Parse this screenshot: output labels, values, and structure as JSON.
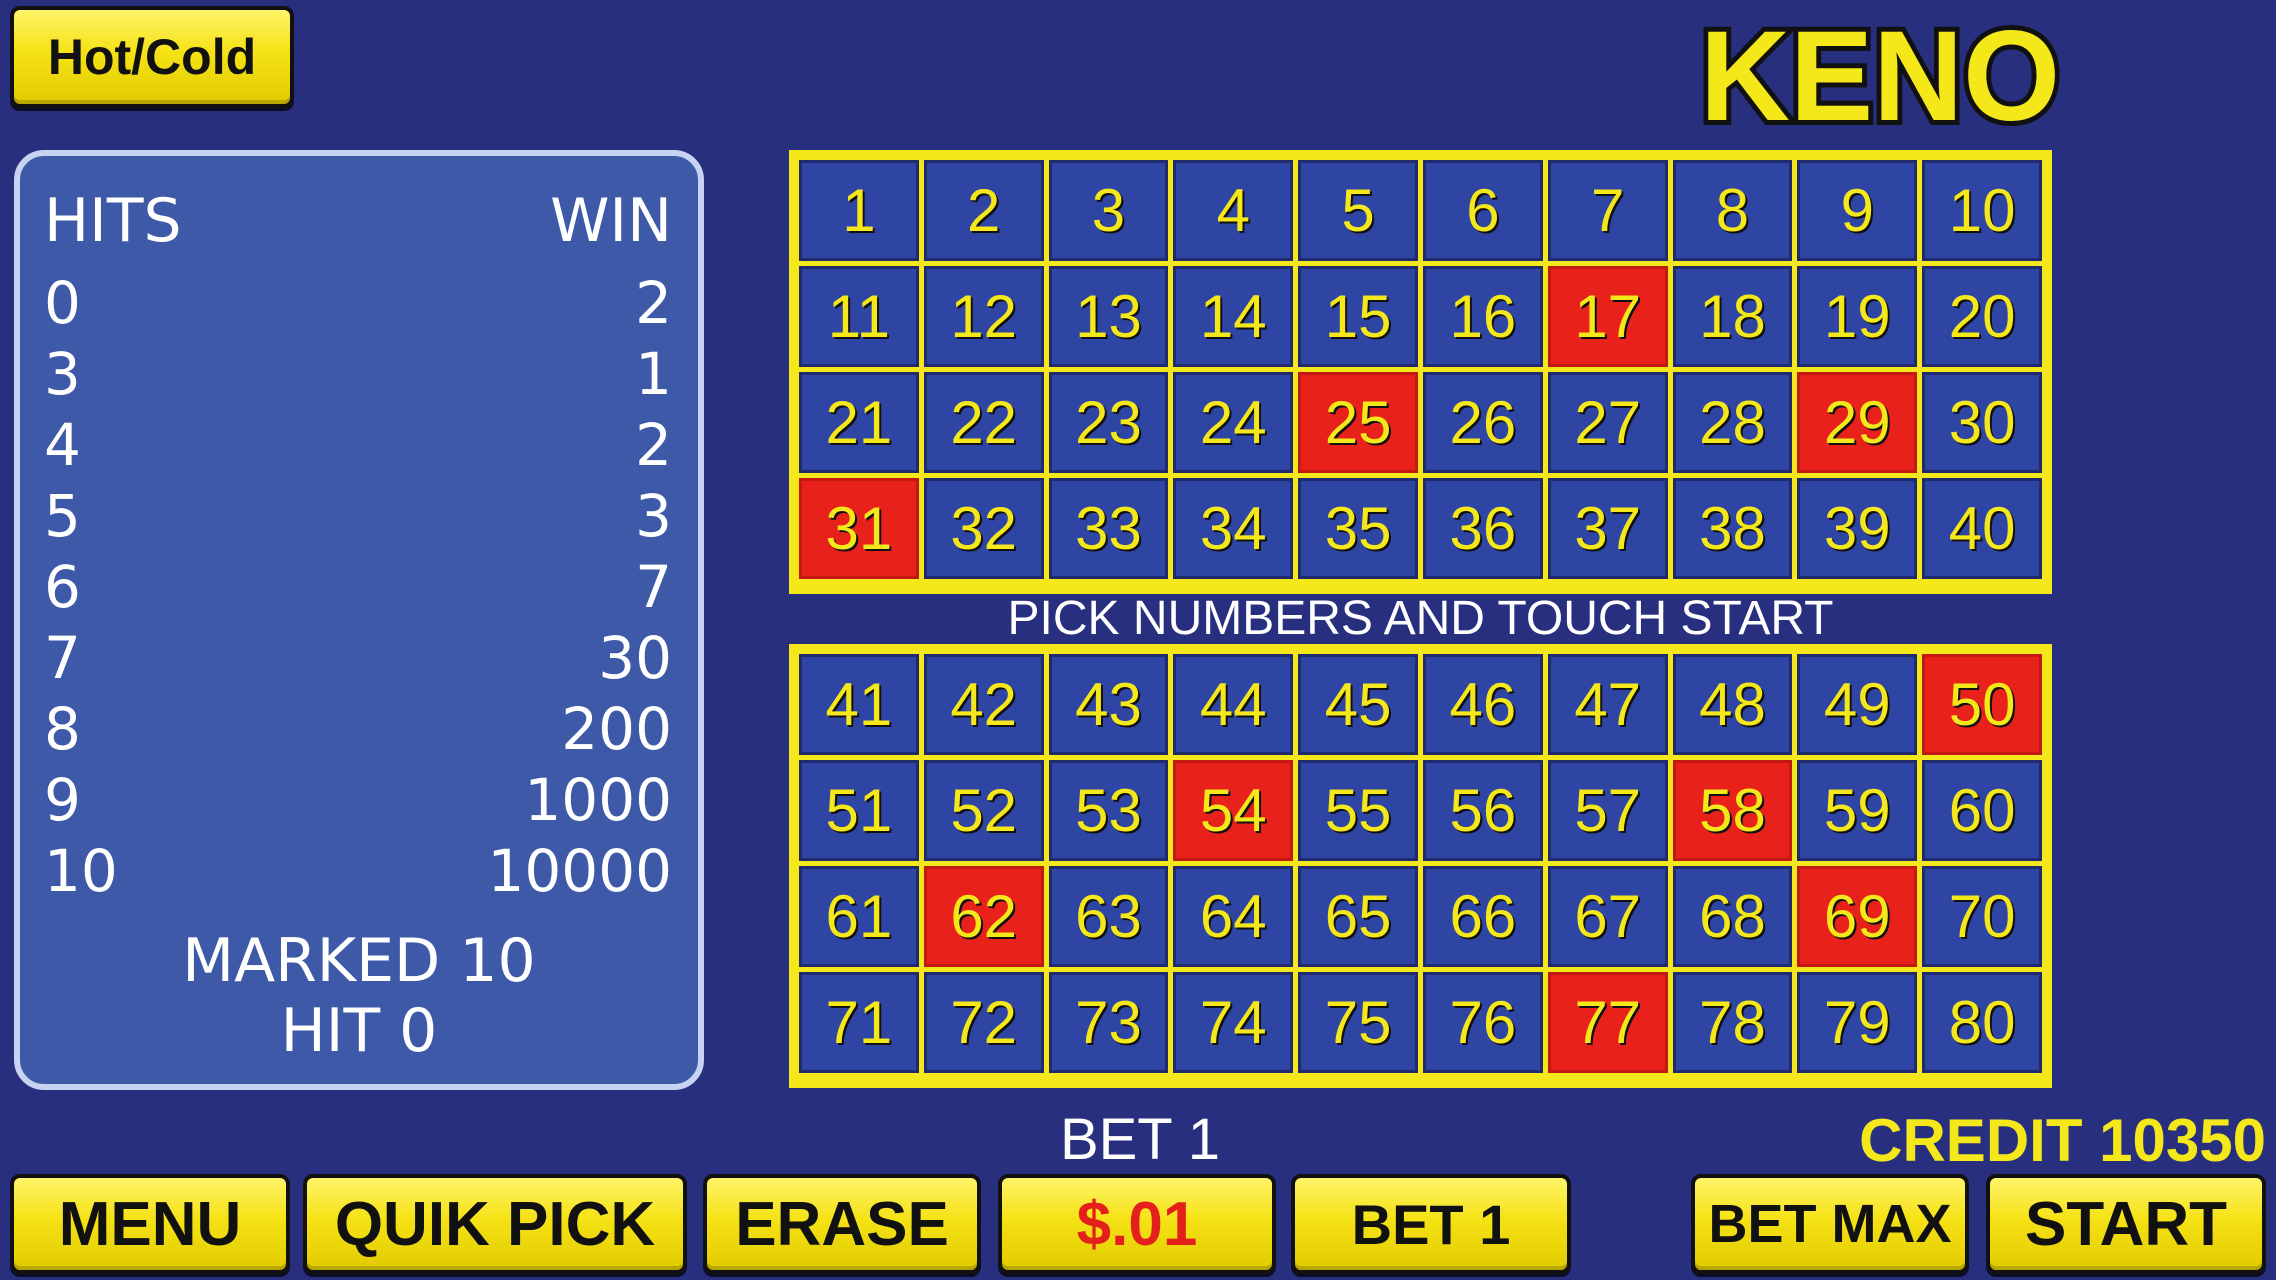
{
  "header": {
    "hotcold_label": "Hot/Cold",
    "logo_text": "KENO"
  },
  "paytable": {
    "hits_header": "HITS",
    "win_header": "WIN",
    "rows": [
      {
        "hits": "0",
        "win": "2"
      },
      {
        "hits": "3",
        "win": "1"
      },
      {
        "hits": "4",
        "win": "2"
      },
      {
        "hits": "5",
        "win": "3"
      },
      {
        "hits": "6",
        "win": "7"
      },
      {
        "hits": "7",
        "win": "30"
      },
      {
        "hits": "8",
        "win": "200"
      },
      {
        "hits": "9",
        "win": "1000"
      },
      {
        "hits": "10",
        "win": "10000"
      }
    ],
    "marked_text": "MARKED 10",
    "hit_text": "HIT 0"
  },
  "board": {
    "prompt": "PICK NUMBERS AND TOUCH START",
    "selected": [
      17,
      25,
      29,
      31,
      50,
      54,
      58,
      62,
      69,
      77
    ],
    "total_numbers": 80
  },
  "status": {
    "bet_label": "BET 1",
    "credit_label": "CREDIT 10350"
  },
  "buttons": {
    "menu": "MENU",
    "quik_pick": "QUIK PICK",
    "erase": "ERASE",
    "denomination": "$.01",
    "bet_one": "BET 1",
    "bet_max": "BET MAX",
    "start": "START"
  },
  "colors": {
    "background": "#292f7f",
    "cell": "#2f45a3",
    "selected_cell": "#e8221b",
    "board_frame": "#f5e81a",
    "number_text": "#f5e81a",
    "credit_text": "#f5e81a",
    "denomination_text": "#e3201b"
  }
}
